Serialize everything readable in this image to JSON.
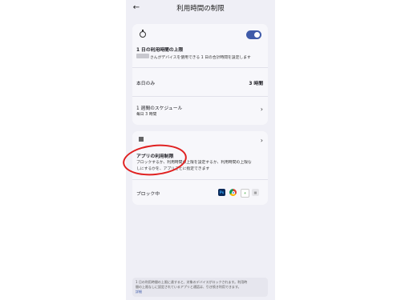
{
  "header": {
    "title": "利用時間の制限",
    "back_icon": "arrow-left-icon"
  },
  "daily_limit": {
    "icon": "timer-icon",
    "toggle_on": true,
    "title": "1 日の利用時間の上限",
    "description": "さんがデバイスを使用できる 1 日の合計時間を設定します",
    "today_label": "本日のみ",
    "today_value": "3 時間",
    "schedule_title": "1 週間のスケジュール",
    "schedule_sub": "毎日 3 時間"
  },
  "app_limits": {
    "icon": "apps-grid-icon",
    "title": "アプリの利用制限",
    "description_line1": "ブロックするか、利用時間の上限を設定するか、利用時間の上限な",
    "description_line2": "しにするかを、アプリごとに指定できます",
    "blocked_label": "ブロック中",
    "blocked_apps": [
      {
        "name": "Ps",
        "icon": "photoshop-icon"
      },
      {
        "name": "",
        "icon": "chrome-icon"
      },
      {
        "name": "",
        "icon": "tree-app-icon"
      },
      {
        "name": "",
        "icon": "grid-app-icon"
      }
    ]
  },
  "footer": {
    "line1": "1 日の利用時間の上限に達すると、対象のデバイスがロックされます。利用時",
    "line2": "間の上限なしに設定されているアプリと通話は、引き続き利用できます。",
    "link": "詳細"
  },
  "colors": {
    "toggle": "#3f5ba9",
    "annotation_circle": "#e02020",
    "background": "#efeff6"
  }
}
